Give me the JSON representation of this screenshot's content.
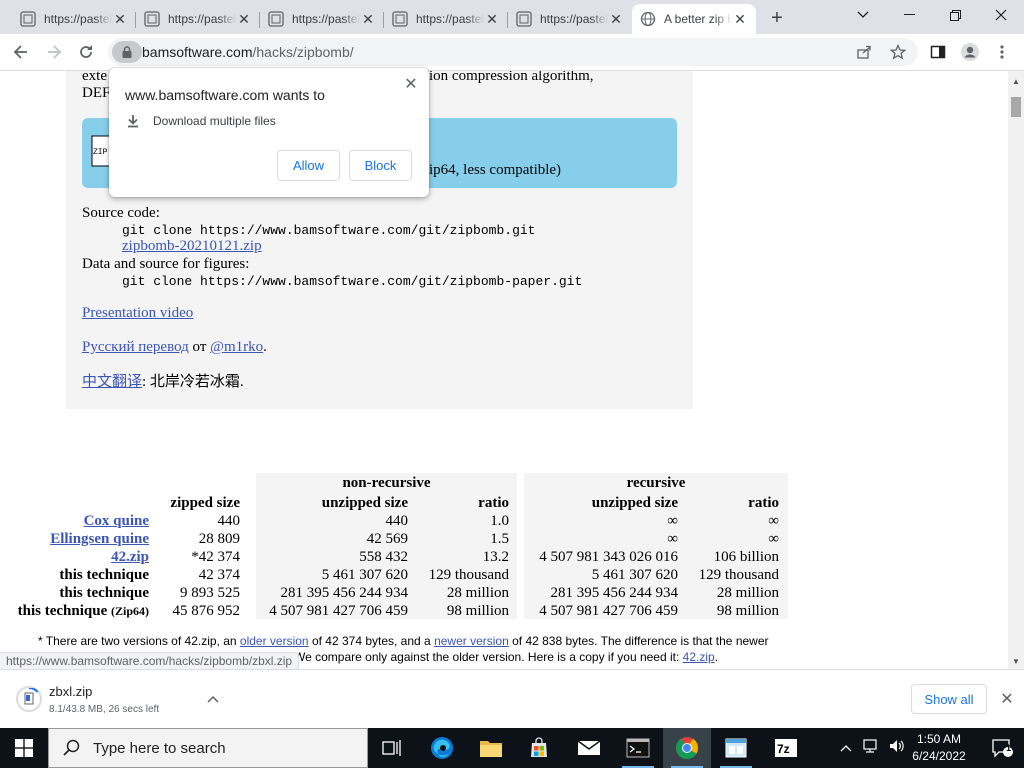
{
  "browser": {
    "tabs": [
      {
        "title": "https://pastebin.com",
        "active": false
      },
      {
        "title": "https://pastebin.com",
        "active": false
      },
      {
        "title": "https://pastebin.com",
        "active": false
      },
      {
        "title": "https://pastebin.com",
        "active": false
      },
      {
        "title": "https://pastebin.com",
        "active": false
      },
      {
        "title": "A better zip bomb",
        "active": true
      }
    ],
    "url_host": "bamsoftware.com",
    "url_path": "/hacks/zipbomb/"
  },
  "page": {
    "intro_line1": "exte",
    "intro_line1_tail": "ion compression algorithm,",
    "intro_line2": "DEF",
    "blue_text": "ip64, less compatible)",
    "source_code_label": "Source code:",
    "git_clone_1": "git clone https://www.bamsoftware.com/git/zipbomb.git",
    "zip_link": "zipbomb-20210121.zip",
    "data_source_label": "Data and source for figures:",
    "git_clone_2": "git clone https://www.bamsoftware.com/git/zipbomb-paper.git",
    "presentation_link": "Presentation video",
    "russian_link": "Русский перевод",
    "russian_from": "от",
    "russian_author": "@m1rko",
    "russian_end": ".",
    "chinese_link": "中文翻译",
    "chinese_rest": ": 北岸冷若冰霜."
  },
  "table": {
    "group_nonrec": "non-recursive",
    "group_rec": "recursive",
    "col_zipped": "zipped size",
    "col_unzipped": "unzipped size",
    "col_ratio": "ratio",
    "rows": [
      {
        "name": "Cox quine",
        "link": true,
        "zipped": "440",
        "nr_unzipped": "440",
        "nr_ratio": "1.0",
        "r_unzipped": "∞",
        "r_ratio": "∞"
      },
      {
        "name": "Ellingsen quine",
        "link": true,
        "zipped": "28 809",
        "nr_unzipped": "42 569",
        "nr_ratio": "1.5",
        "r_unzipped": "∞",
        "r_ratio": "∞"
      },
      {
        "name": "42.zip",
        "link": true,
        "zipped": "*42 374",
        "nr_unzipped": "558 432",
        "nr_ratio": "13.2",
        "r_unzipped": "4 507 981 343 026 016",
        "r_ratio": "106 billion"
      },
      {
        "name": "this technique",
        "link": false,
        "zipped": "42 374",
        "nr_unzipped": "5 461 307 620",
        "nr_ratio": "129 thousand",
        "r_unzipped": "5 461 307 620",
        "r_ratio": "129 thousand"
      },
      {
        "name": "this technique",
        "link": false,
        "zipped": "9 893 525",
        "nr_unzipped": "281 395 456 244 934",
        "nr_ratio": "28 million",
        "r_unzipped": "281 395 456 244 934",
        "r_ratio": "28 million"
      },
      {
        "name": "this technique",
        "suffix": "(Zip64)",
        "link": false,
        "zipped": "45 876 952",
        "nr_unzipped": "4 507 981 427 706 459",
        "nr_ratio": "98 million",
        "r_unzipped": "4 507 981 427 706 459",
        "r_ratio": "98 million"
      }
    ]
  },
  "footnote": {
    "part1": "* There are two versions of 42.zip, an",
    "older_link": "older version",
    "part2": "of 42 374 bytes, and a",
    "newer_link": "newer version",
    "part3": "of 42 838 bytes. The difference is that the newer",
    "line2_part": "We compare only against the older version. Here is a copy if you need it:",
    "copy_link": "42.zip",
    "line2_end": "."
  },
  "status_url": "https://www.bamsoftware.com/hacks/zipbomb/zbxl.zip",
  "popup": {
    "title": "www.bamsoftware.com wants to",
    "permission": "Download multiple files",
    "allow": "Allow",
    "block": "Block"
  },
  "download": {
    "filename": "zbxl.zip",
    "status": "8.1/43.8 MB, 26 secs left",
    "show_all": "Show all"
  },
  "taskbar": {
    "search_placeholder": "Type here to search",
    "time": "1:50 AM",
    "date": "6/24/2022",
    "notification_count": "1"
  },
  "colors": {
    "link": "#3b55b3",
    "blue_box": "#87ceeb",
    "accent": "#1a73e8"
  }
}
